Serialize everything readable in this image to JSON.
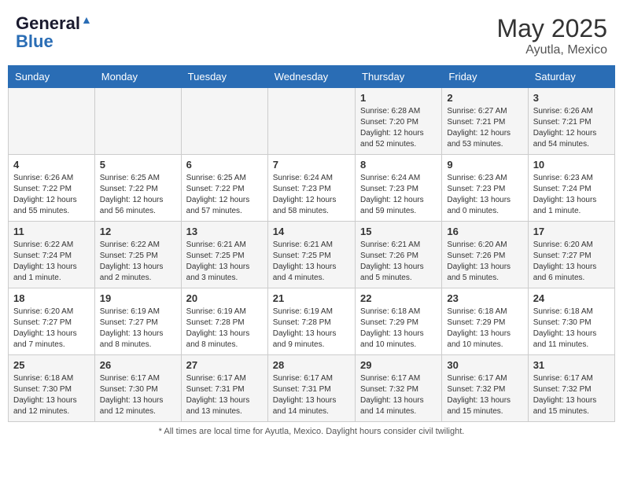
{
  "header": {
    "logo_line1": "General",
    "logo_line2": "Blue",
    "month_year": "May 2025",
    "location": "Ayutla, Mexico"
  },
  "days_of_week": [
    "Sunday",
    "Monday",
    "Tuesday",
    "Wednesday",
    "Thursday",
    "Friday",
    "Saturday"
  ],
  "weeks": [
    [
      {
        "num": "",
        "info": ""
      },
      {
        "num": "",
        "info": ""
      },
      {
        "num": "",
        "info": ""
      },
      {
        "num": "",
        "info": ""
      },
      {
        "num": "1",
        "info": "Sunrise: 6:28 AM\nSunset: 7:20 PM\nDaylight: 12 hours\nand 52 minutes."
      },
      {
        "num": "2",
        "info": "Sunrise: 6:27 AM\nSunset: 7:21 PM\nDaylight: 12 hours\nand 53 minutes."
      },
      {
        "num": "3",
        "info": "Sunrise: 6:26 AM\nSunset: 7:21 PM\nDaylight: 12 hours\nand 54 minutes."
      }
    ],
    [
      {
        "num": "4",
        "info": "Sunrise: 6:26 AM\nSunset: 7:22 PM\nDaylight: 12 hours\nand 55 minutes."
      },
      {
        "num": "5",
        "info": "Sunrise: 6:25 AM\nSunset: 7:22 PM\nDaylight: 12 hours\nand 56 minutes."
      },
      {
        "num": "6",
        "info": "Sunrise: 6:25 AM\nSunset: 7:22 PM\nDaylight: 12 hours\nand 57 minutes."
      },
      {
        "num": "7",
        "info": "Sunrise: 6:24 AM\nSunset: 7:23 PM\nDaylight: 12 hours\nand 58 minutes."
      },
      {
        "num": "8",
        "info": "Sunrise: 6:24 AM\nSunset: 7:23 PM\nDaylight: 12 hours\nand 59 minutes."
      },
      {
        "num": "9",
        "info": "Sunrise: 6:23 AM\nSunset: 7:23 PM\nDaylight: 13 hours\nand 0 minutes."
      },
      {
        "num": "10",
        "info": "Sunrise: 6:23 AM\nSunset: 7:24 PM\nDaylight: 13 hours\nand 1 minute."
      }
    ],
    [
      {
        "num": "11",
        "info": "Sunrise: 6:22 AM\nSunset: 7:24 PM\nDaylight: 13 hours\nand 1 minute."
      },
      {
        "num": "12",
        "info": "Sunrise: 6:22 AM\nSunset: 7:25 PM\nDaylight: 13 hours\nand 2 minutes."
      },
      {
        "num": "13",
        "info": "Sunrise: 6:21 AM\nSunset: 7:25 PM\nDaylight: 13 hours\nand 3 minutes."
      },
      {
        "num": "14",
        "info": "Sunrise: 6:21 AM\nSunset: 7:25 PM\nDaylight: 13 hours\nand 4 minutes."
      },
      {
        "num": "15",
        "info": "Sunrise: 6:21 AM\nSunset: 7:26 PM\nDaylight: 13 hours\nand 5 minutes."
      },
      {
        "num": "16",
        "info": "Sunrise: 6:20 AM\nSunset: 7:26 PM\nDaylight: 13 hours\nand 5 minutes."
      },
      {
        "num": "17",
        "info": "Sunrise: 6:20 AM\nSunset: 7:27 PM\nDaylight: 13 hours\nand 6 minutes."
      }
    ],
    [
      {
        "num": "18",
        "info": "Sunrise: 6:20 AM\nSunset: 7:27 PM\nDaylight: 13 hours\nand 7 minutes."
      },
      {
        "num": "19",
        "info": "Sunrise: 6:19 AM\nSunset: 7:27 PM\nDaylight: 13 hours\nand 8 minutes."
      },
      {
        "num": "20",
        "info": "Sunrise: 6:19 AM\nSunset: 7:28 PM\nDaylight: 13 hours\nand 8 minutes."
      },
      {
        "num": "21",
        "info": "Sunrise: 6:19 AM\nSunset: 7:28 PM\nDaylight: 13 hours\nand 9 minutes."
      },
      {
        "num": "22",
        "info": "Sunrise: 6:18 AM\nSunset: 7:29 PM\nDaylight: 13 hours\nand 10 minutes."
      },
      {
        "num": "23",
        "info": "Sunrise: 6:18 AM\nSunset: 7:29 PM\nDaylight: 13 hours\nand 10 minutes."
      },
      {
        "num": "24",
        "info": "Sunrise: 6:18 AM\nSunset: 7:30 PM\nDaylight: 13 hours\nand 11 minutes."
      }
    ],
    [
      {
        "num": "25",
        "info": "Sunrise: 6:18 AM\nSunset: 7:30 PM\nDaylight: 13 hours\nand 12 minutes."
      },
      {
        "num": "26",
        "info": "Sunrise: 6:17 AM\nSunset: 7:30 PM\nDaylight: 13 hours\nand 12 minutes."
      },
      {
        "num": "27",
        "info": "Sunrise: 6:17 AM\nSunset: 7:31 PM\nDaylight: 13 hours\nand 13 minutes."
      },
      {
        "num": "28",
        "info": "Sunrise: 6:17 AM\nSunset: 7:31 PM\nDaylight: 13 hours\nand 14 minutes."
      },
      {
        "num": "29",
        "info": "Sunrise: 6:17 AM\nSunset: 7:32 PM\nDaylight: 13 hours\nand 14 minutes."
      },
      {
        "num": "30",
        "info": "Sunrise: 6:17 AM\nSunset: 7:32 PM\nDaylight: 13 hours\nand 15 minutes."
      },
      {
        "num": "31",
        "info": "Sunrise: 6:17 AM\nSunset: 7:32 PM\nDaylight: 13 hours\nand 15 minutes."
      }
    ]
  ],
  "footer": "Daylight hours"
}
